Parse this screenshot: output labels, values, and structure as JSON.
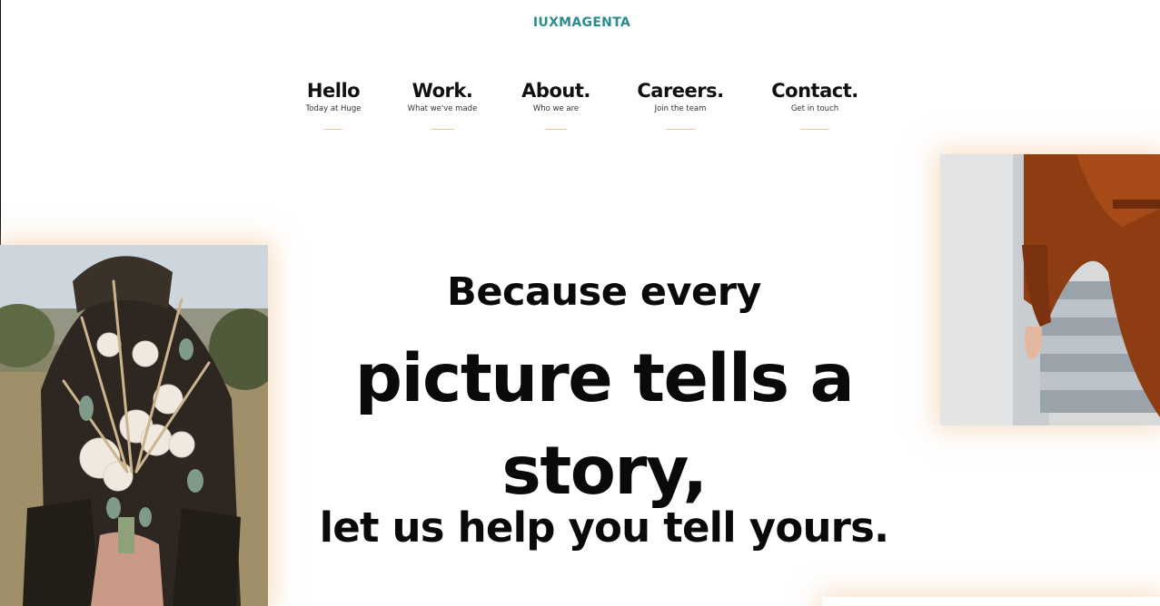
{
  "brand": "IUXMAGENTA",
  "nav": {
    "items": [
      {
        "label": "Hello",
        "sub": "Today at Huge"
      },
      {
        "label": "Work.",
        "sub": "What we've made"
      },
      {
        "label": "About.",
        "sub": "Who we are"
      },
      {
        "label": "Careers.",
        "sub": "Join the team"
      },
      {
        "label": "Contact.",
        "sub": "Get in touch"
      }
    ]
  },
  "hero": {
    "line1": "Because every",
    "line2": "picture tells a",
    "line3": "story,",
    "line4": "let us help you tell yours."
  },
  "colors": {
    "brand": "#2a8c8c",
    "accent_underline": "#e8c79a",
    "photo_glow": "#f4c496"
  }
}
